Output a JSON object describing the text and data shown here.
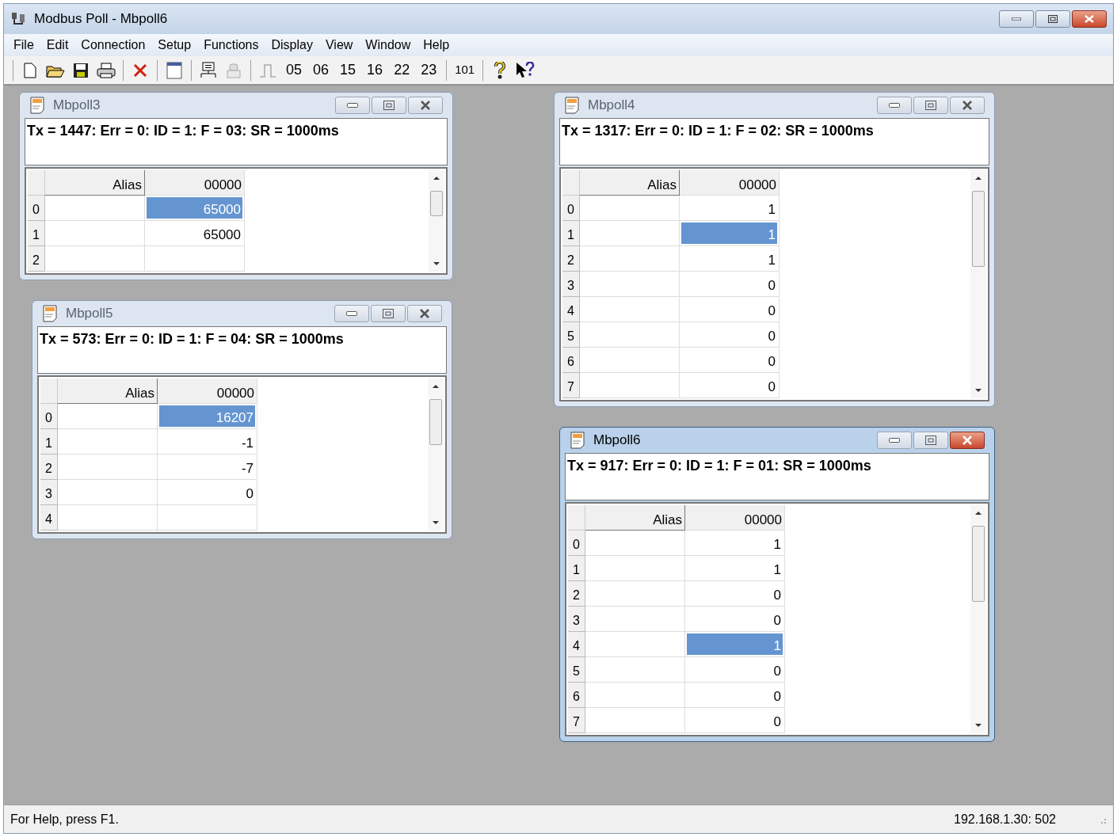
{
  "window": {
    "title": "Modbus Poll - Mbpoll6"
  },
  "menu": [
    "File",
    "Edit",
    "Connection",
    "Setup",
    "Functions",
    "Display",
    "View",
    "Window",
    "Help"
  ],
  "toolbar": {
    "function_codes": [
      "05",
      "06",
      "15",
      "16",
      "22",
      "23"
    ],
    "count_button": "101"
  },
  "documents": [
    {
      "title": "Mbpoll3",
      "active": false,
      "status_line": "Tx = 1447: Err = 0: ID = 1: F = 03: SR = 1000ms",
      "columns": [
        "Alias",
        "00000"
      ],
      "rows": [
        {
          "row": "0",
          "value": "65000",
          "selected": true
        },
        {
          "row": "1",
          "value": "65000",
          "selected": false
        },
        {
          "row": "2",
          "selected": false
        }
      ]
    },
    {
      "title": "Mbpoll5",
      "active": false,
      "status_line": "Tx = 573: Err = 0: ID = 1: F = 04: SR = 1000ms",
      "columns": [
        "Alias",
        "00000"
      ],
      "rows": [
        {
          "row": "0",
          "value": "16207",
          "selected": true
        },
        {
          "row": "1",
          "value": "-1",
          "selected": false
        },
        {
          "row": "2",
          "value": "-7",
          "selected": false
        },
        {
          "row": "3",
          "value": "0",
          "selected": false
        },
        {
          "row": "4",
          "selected": false
        }
      ]
    },
    {
      "title": "Mbpoll4",
      "active": false,
      "status_line": "Tx = 1317: Err = 0: ID = 1: F = 02: SR = 1000ms",
      "columns": [
        "Alias",
        "00000"
      ],
      "rows": [
        {
          "row": "0",
          "value": "1",
          "selected": false
        },
        {
          "row": "1",
          "value": "1",
          "selected": true
        },
        {
          "row": "2",
          "value": "1",
          "selected": false
        },
        {
          "row": "3",
          "value": "0",
          "selected": false
        },
        {
          "row": "4",
          "value": "0",
          "selected": false
        },
        {
          "row": "5",
          "value": "0",
          "selected": false
        },
        {
          "row": "6",
          "value": "0",
          "selected": false
        },
        {
          "row": "7",
          "value": "0",
          "selected": false
        }
      ]
    },
    {
      "title": "Mbpoll6",
      "active": true,
      "status_line": "Tx = 917: Err = 0: ID = 1: F = 01: SR = 1000ms",
      "columns": [
        "Alias",
        "00000"
      ],
      "rows": [
        {
          "row": "0",
          "value": "1",
          "selected": false
        },
        {
          "row": "1",
          "value": "1",
          "selected": false
        },
        {
          "row": "2",
          "value": "0",
          "selected": false
        },
        {
          "row": "3",
          "value": "0",
          "selected": false
        },
        {
          "row": "4",
          "value": "1",
          "selected": true
        },
        {
          "row": "5",
          "value": "0",
          "selected": false
        },
        {
          "row": "6",
          "value": "0",
          "selected": false
        },
        {
          "row": "7",
          "value": "0",
          "selected": false
        }
      ]
    }
  ],
  "status_bar": {
    "help": "For Help, press F1.",
    "connection": "192.168.1.30: 502"
  }
}
